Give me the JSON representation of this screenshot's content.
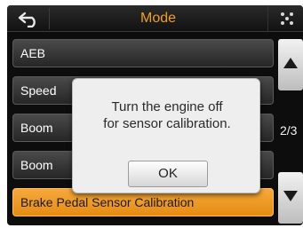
{
  "header": {
    "title": "Mode",
    "back_icon": "back-arrow-icon",
    "menu_icon": "grid-dots-icon"
  },
  "list": {
    "items": [
      {
        "label": "AEB",
        "selected": false
      },
      {
        "label": "Speed",
        "selected": false
      },
      {
        "label": "Boom",
        "selected": false
      },
      {
        "label": "Boom",
        "selected": false
      },
      {
        "label": "Brake Pedal Sensor Calibration",
        "selected": true
      }
    ]
  },
  "pager": {
    "page": "2/3",
    "up_icon": "arrow-up-icon",
    "down_icon": "arrow-down-icon"
  },
  "dialog": {
    "message_line1": "Turn the engine off",
    "message_line2": "for sensor calibration.",
    "ok_label": "OK"
  },
  "colors": {
    "accent": "#f0a020",
    "selected_item": "#f0a030",
    "background": "#0d0d0d"
  }
}
